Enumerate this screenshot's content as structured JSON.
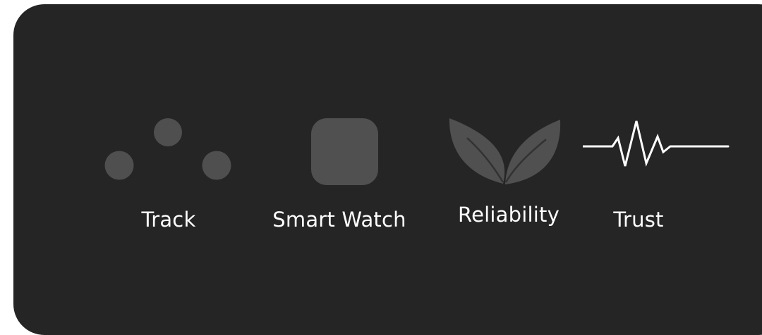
{
  "features": [
    {
      "label": "Track",
      "icon": "three-dots-icon",
      "icon_color": "#4f4f4f"
    },
    {
      "label": "Smart Watch",
      "icon": "rounded-square-icon",
      "icon_color": "#505050"
    },
    {
      "label": "Reliability",
      "icon": "leaves-icon",
      "icon_color": "#505050"
    },
    {
      "label": "Trust",
      "icon": "heartbeat-pulse-icon",
      "icon_color": "#ffffff"
    }
  ],
  "colors": {
    "page_background": "#ffffff",
    "card_background": "#252525",
    "label_text": "#ffffff"
  }
}
